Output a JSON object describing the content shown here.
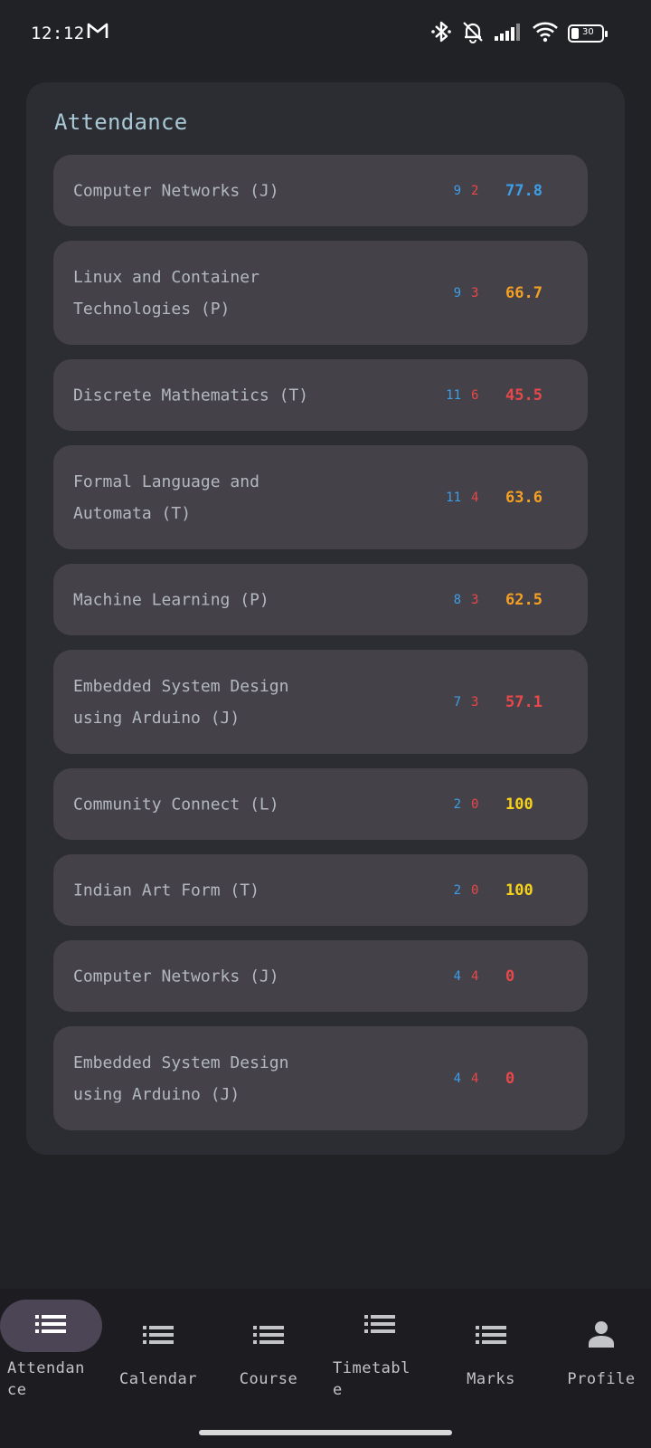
{
  "status_bar": {
    "time": "12:12",
    "battery": "30",
    "icons": [
      "gmail-icon",
      "bluetooth-icon",
      "bell-off-icon",
      "signal-icon",
      "wifi-icon",
      "battery-icon"
    ]
  },
  "attendance": {
    "title": "Attendance",
    "rows": [
      {
        "name": "Computer Networks (J)",
        "present": "9",
        "absent": "2",
        "percent": "77.8",
        "percent_color": "#3c9ee8"
      },
      {
        "name": "Linux and Container Technologies (P)",
        "present": "9",
        "absent": "3",
        "percent": "66.7",
        "percent_color": "#f5a023"
      },
      {
        "name": "Discrete Mathematics (T)",
        "present": "11",
        "absent": "6",
        "percent": "45.5",
        "percent_color": "#e8484a"
      },
      {
        "name": "Formal Language and Automata (T)",
        "present": "11",
        "absent": "4",
        "percent": "63.6",
        "percent_color": "#f5a023"
      },
      {
        "name": "Machine Learning (P)",
        "present": "8",
        "absent": "3",
        "percent": "62.5",
        "percent_color": "#f5a023"
      },
      {
        "name": "Embedded System Design using Arduino (J)",
        "present": "7",
        "absent": "3",
        "percent": "57.1",
        "percent_color": "#e8484a"
      },
      {
        "name": "Community Connect (L)",
        "present": "2",
        "absent": "0",
        "percent": "100",
        "percent_color": "#f7d21b"
      },
      {
        "name": "Indian Art Form (T)",
        "present": "2",
        "absent": "0",
        "percent": "100",
        "percent_color": "#f7d21b"
      },
      {
        "name": "Computer Networks (J)",
        "present": "4",
        "absent": "4",
        "percent": "0",
        "percent_color": "#e8484a"
      },
      {
        "name": "Embedded System Design using Arduino (J)",
        "present": "4",
        "absent": "4",
        "percent": "0",
        "percent_color": "#e8484a"
      }
    ]
  },
  "bottom_nav": {
    "active": "attendance",
    "items": [
      {
        "label": "Attendance",
        "icon": "list-icon"
      },
      {
        "label": "Calendar",
        "icon": "list-icon"
      },
      {
        "label": "Course",
        "icon": "list-icon"
      },
      {
        "label": "Timetable",
        "icon": "list-icon"
      },
      {
        "label": "Marks",
        "icon": "list-icon"
      },
      {
        "label": "Profile",
        "icon": "person-icon"
      }
    ]
  },
  "colors": {
    "present": "#3c9ee8",
    "absent": "#e8484a",
    "title": "#a9c8d6"
  }
}
